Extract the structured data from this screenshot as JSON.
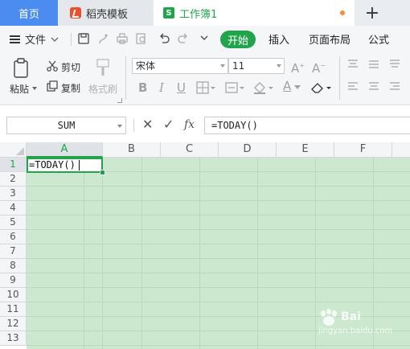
{
  "tabs": {
    "home": "首页",
    "templates": "稻壳模板",
    "workbook": "工作簿1",
    "new_tab": "+"
  },
  "menu": {
    "file": "文件",
    "start": "开始",
    "insert": "插入",
    "page_layout": "页面布局",
    "formulas": "公式"
  },
  "ribbon": {
    "paste": "粘贴",
    "cut": "剪切",
    "copy": "复制",
    "format_painter": "格式刷",
    "font_name": "宋体",
    "font_size": "11",
    "bold": "B",
    "italic": "I",
    "underline": "U",
    "font_color": "A"
  },
  "formula_bar": {
    "name_box": "SUM",
    "cancel": "✕",
    "confirm": "✓",
    "fx": "fx",
    "content": "=TODAY()"
  },
  "grid": {
    "columns": [
      "A",
      "B",
      "C",
      "D",
      "E",
      "F"
    ],
    "rows": [
      "1",
      "2",
      "3",
      "4",
      "5",
      "6",
      "7",
      "8",
      "9",
      "10",
      "11",
      "12",
      "13"
    ],
    "active_cell_text": "=TODAY()"
  },
  "watermark": {
    "brand": "Bai",
    "sub": "jingyan.baidu.com"
  },
  "colors": {
    "accent_green": "#22a44d",
    "home_tab_blue": "#4a8cf0",
    "sheet_bg": "#cce8cf"
  }
}
